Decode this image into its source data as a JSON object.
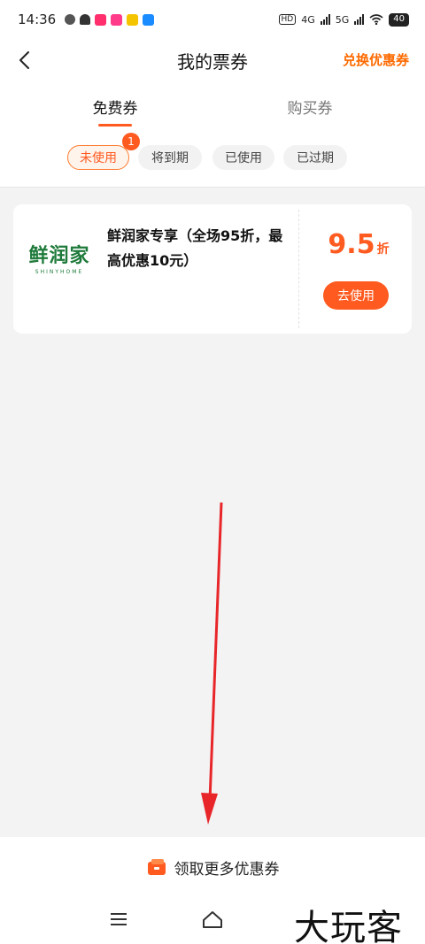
{
  "status_bar": {
    "time": "14:36",
    "network_left": "HD",
    "network_a": "4G",
    "network_b": "5G",
    "battery": "40"
  },
  "header": {
    "title": "我的票券",
    "exchange_label": "兑换优惠券"
  },
  "tabs": [
    {
      "label": "免费券",
      "active": true
    },
    {
      "label": "购买券",
      "active": false
    }
  ],
  "filters": {
    "items": [
      {
        "label": "未使用",
        "active": true
      },
      {
        "label": "将到期",
        "active": false
      },
      {
        "label": "已使用",
        "active": false
      },
      {
        "label": "已过期",
        "active": false
      }
    ],
    "unused_badge": "1"
  },
  "coupon": {
    "brand_logo_cn": "鲜润家",
    "brand_logo_en": "SHINYHOME",
    "title": "鲜润家专享（全场95折，最高优惠10元）",
    "discount_value": "9.5",
    "discount_unit": "折",
    "use_button": "去使用"
  },
  "bottom_bar": {
    "label": "领取更多优惠券"
  },
  "watermark": "大玩客",
  "colors": {
    "accent": "#ff5a1f",
    "brand_green": "#1e7a3a",
    "annotation_red": "#e8262a"
  }
}
